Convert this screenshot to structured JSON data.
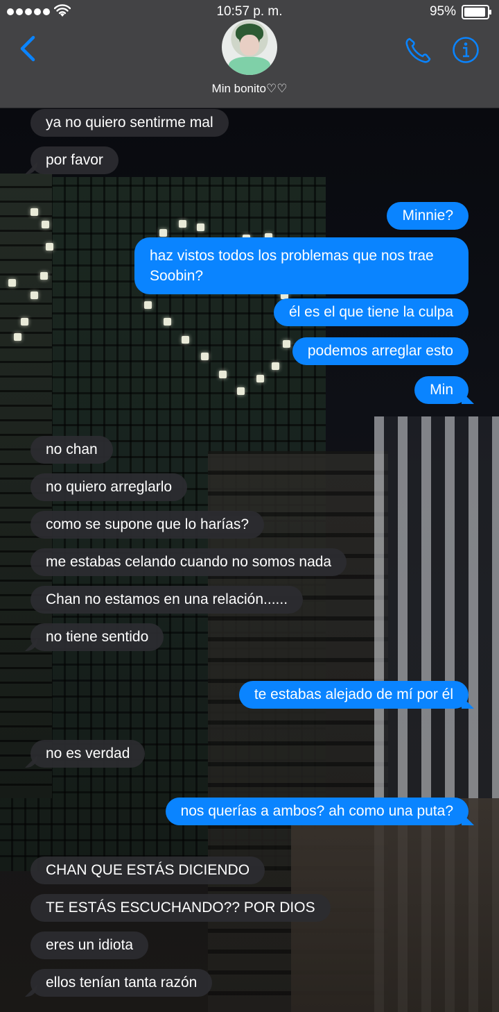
{
  "status_bar": {
    "time": "10:57 p. m.",
    "battery": "95%"
  },
  "header": {
    "contact_name": "Min bonito♡♡",
    "icons": [
      "back-chevron-icon",
      "avatar",
      "phone-icon",
      "info-icon"
    ]
  },
  "colors": {
    "accent": "#0a84ff",
    "incoming_bubble": "#2c2c30",
    "nav_bar": "#464648"
  },
  "messages": [
    {
      "from": "them",
      "text": "ya no quiero sentirme mal"
    },
    {
      "from": "them",
      "text": "por favor"
    },
    {
      "from": "me",
      "text": "Minnie?"
    },
    {
      "from": "me",
      "text": "haz vistos todos los problemas que nos trae Soobin?"
    },
    {
      "from": "me",
      "text": "él es el que tiene la culpa"
    },
    {
      "from": "me",
      "text": "podemos arreglar esto"
    },
    {
      "from": "me",
      "text": "Min"
    },
    {
      "from": "them",
      "text": "no chan"
    },
    {
      "from": "them",
      "text": "no quiero arreglarlo"
    },
    {
      "from": "them",
      "text": "como se supone que lo harías?"
    },
    {
      "from": "them",
      "text": "me estabas celando cuando no somos nada"
    },
    {
      "from": "them",
      "text": "Chan no estamos en una relación......"
    },
    {
      "from": "them",
      "text": "no tiene sentido"
    },
    {
      "from": "me",
      "text": "te estabas alejado de mí por él"
    },
    {
      "from": "them",
      "text": "no es verdad"
    },
    {
      "from": "me",
      "text": "nos querías a ambos? ah como una puta?"
    },
    {
      "from": "them",
      "text": "CHAN QUE ESTÁS DICIENDO"
    },
    {
      "from": "them",
      "text": "TE ESTÁS ESCUCHANDO?? POR DIOS"
    },
    {
      "from": "them",
      "text": "eres un idiota"
    },
    {
      "from": "them",
      "text": "ellos tenían tanta razón"
    }
  ]
}
